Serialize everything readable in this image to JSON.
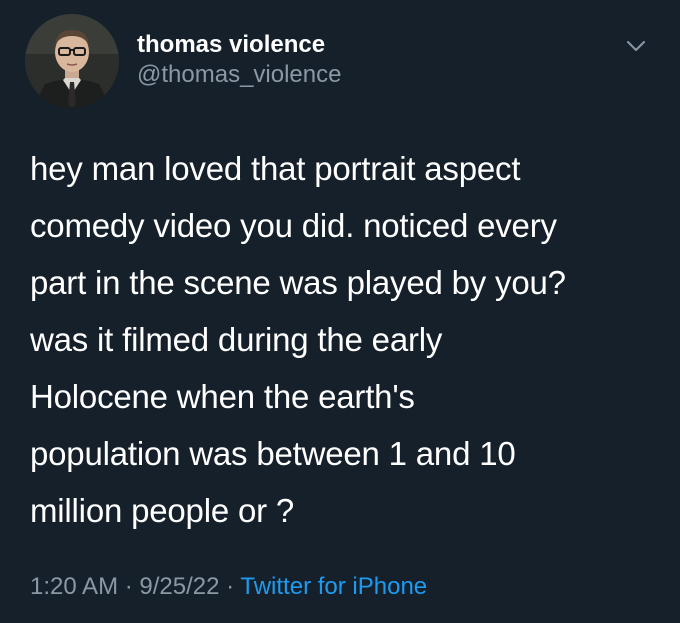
{
  "tweet": {
    "author": {
      "display_name": "thomas violence",
      "handle": "@thomas_violence"
    },
    "text_lines": [
      "hey man loved that portrait aspect",
      "comedy video you did. noticed every",
      "part in the scene was played by you?",
      "was it filmed during the early",
      "Holocene when the earth's",
      "population was between 1 and 10",
      "million people or ?"
    ],
    "time": "1:20 AM",
    "date": "9/25/22",
    "separator": "·",
    "source": "Twitter for iPhone"
  },
  "colors": {
    "background": "#15202b",
    "primary_text": "#ffffff",
    "secondary_text": "#8b98a5",
    "link": "#1d9bf0"
  },
  "icons": {
    "avatar": "profile-photo",
    "menu": "chevron-down-icon"
  }
}
